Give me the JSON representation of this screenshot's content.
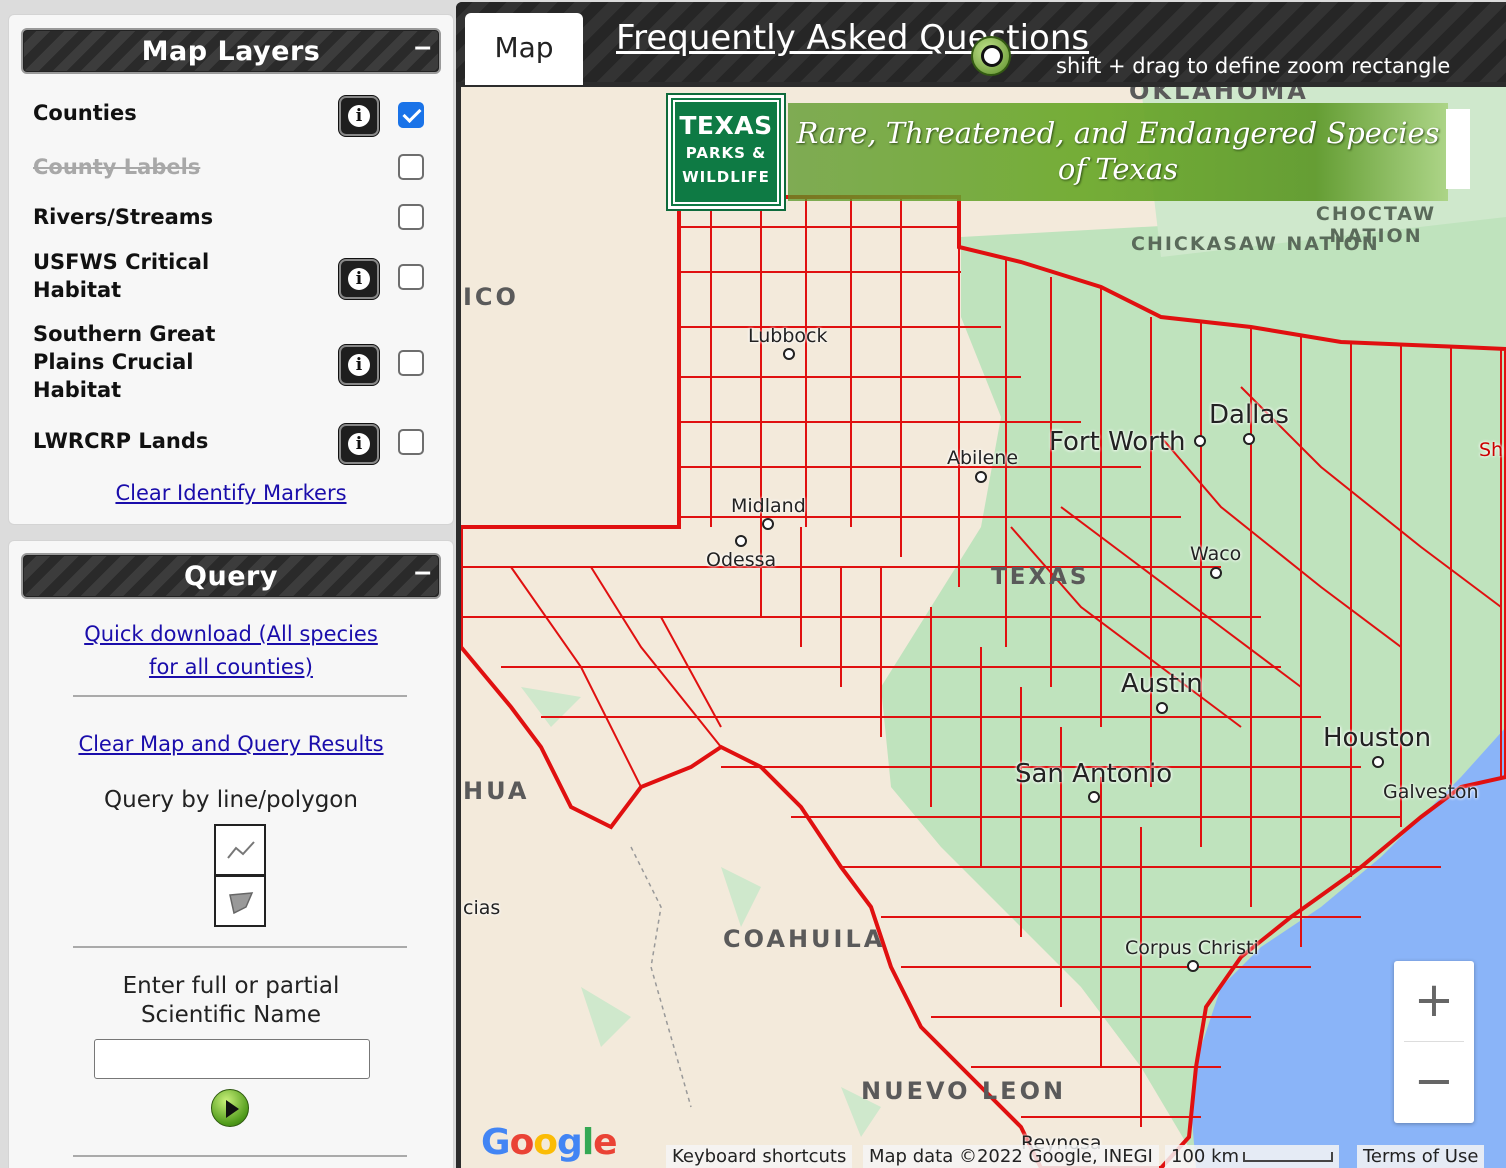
{
  "layers_panel": {
    "title": "Map Layers",
    "collapse_label": "–",
    "layers": [
      {
        "label": "Counties",
        "checked": true,
        "info": true,
        "disabled": false
      },
      {
        "label": "County Labels",
        "checked": false,
        "info": false,
        "disabled": true
      },
      {
        "label": "Rivers/Streams",
        "checked": false,
        "info": false,
        "disabled": false
      },
      {
        "label": "USFWS Critical Habitat",
        "checked": false,
        "info": true,
        "disabled": false
      },
      {
        "label": "Southern Great Plains Crucial Habitat",
        "checked": false,
        "info": true,
        "disabled": false
      },
      {
        "label": "LWRCRP Lands",
        "checked": false,
        "info": true,
        "disabled": false
      }
    ],
    "info_glyph": "i",
    "clear_markers_link": "Clear Identify Markers"
  },
  "query_panel": {
    "title": "Query",
    "collapse_label": "–",
    "quick_download_line1": "Quick download (All species",
    "quick_download_line2": "for all counties)",
    "clear_map_link": "Clear Map and Query Results",
    "query_by_label": "Query by line/polygon",
    "tools": [
      "polyline-tool-icon",
      "polygon-tool-icon"
    ],
    "sci_name_line1": "Enter full or partial",
    "sci_name_line2": "Scientific Name",
    "sci_name_value": ""
  },
  "map_header": {
    "tab_map": "Map",
    "tab_faq": "Frequently Asked Questions",
    "zoom_hint": "shift + drag to define zoom rectangle"
  },
  "banner": {
    "logo_line1": "TEXAS",
    "logo_line2": "PARKS &",
    "logo_line3": "WILDLIFE",
    "title_line1": "Rare, Threatened, and Endangered Species",
    "title_line2": "of Texas"
  },
  "map_labels": {
    "regions": [
      "OKLAHOMA",
      "ICO",
      "HUA",
      "COAHUILA",
      "NUEVO LEON",
      "TEXAS"
    ],
    "nations": [
      "CHICKASAW NATION",
      "CHOCTAW NATION"
    ],
    "cities_big": [
      "Fort Worth",
      "Dallas",
      "Austin",
      "San Antonio",
      "Houston"
    ],
    "cities": [
      "Lubbock",
      "Abilene",
      "Midland",
      "Odessa",
      "Waco",
      "Corpus Christi",
      "Galveston",
      "cias",
      "Reynosa",
      "Sh"
    ]
  },
  "map_controls": {
    "zoom_in": "+",
    "zoom_out": "−",
    "google": "Google",
    "keyboard_shortcuts": "Keyboard shortcuts",
    "map_data": "Map data ©2022 Google, INEGI",
    "scale": "100 km",
    "terms": "Terms of Use"
  },
  "colors": {
    "county_line": "#e01010",
    "land": "#f3eadb",
    "forest": "#b9dfb8",
    "water": "#8ab4f8",
    "link": "#1a0dab",
    "checkbox_checked": "#1a73e8"
  }
}
